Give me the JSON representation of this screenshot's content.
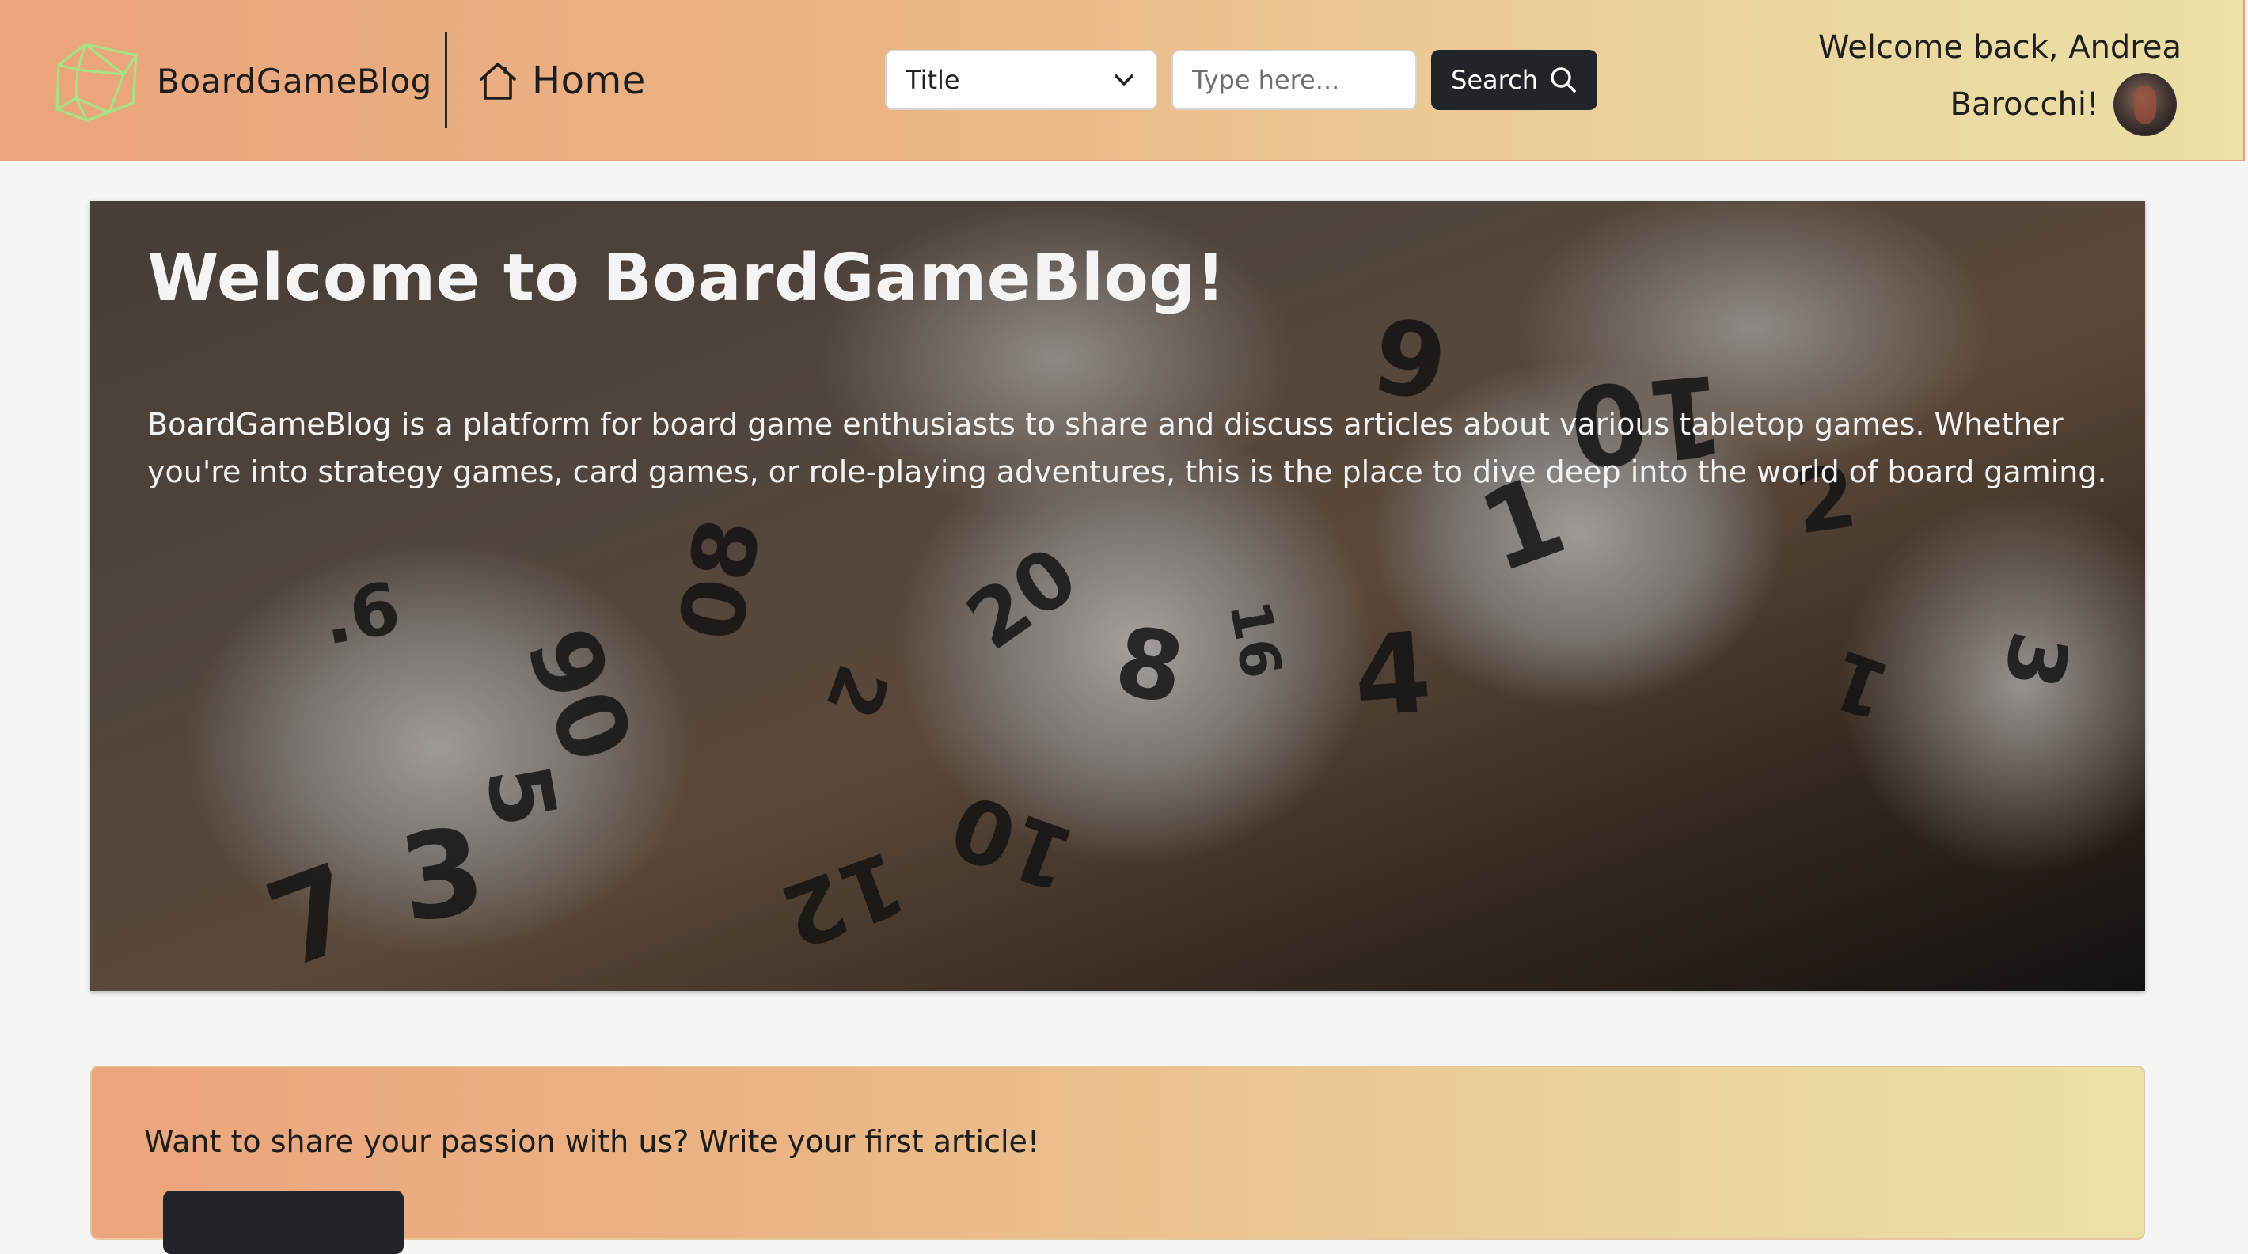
{
  "navbar": {
    "brand_name": "BoardGameBlog",
    "brand_logo_icon": "d20-dice-outline-icon",
    "home_label": "Home",
    "home_icon": "house-icon",
    "welcome_line1": "Welcome back, Andrea",
    "welcome_line2": "Barocchi!",
    "colors": {
      "gradient_start": "#eba47c",
      "gradient_end": "#ebe0a6",
      "logo_green": "#9be07a"
    }
  },
  "search": {
    "filter_selected": "Title",
    "input_placeholder": "Type here...",
    "button_label": "Search",
    "button_color": "#212529"
  },
  "hero": {
    "title": "Welcome to BoardGameBlog!",
    "text": "BoardGameBlog is a platform for board game enthusiasts to share and discuss articles about various tabletop games. Whether you're into strategy games, card games, or role-playing adventures, this is the place to dive deep into the world of board gaming."
  },
  "cta": {
    "text": "Want to share your passion with us? Write your first article!"
  }
}
